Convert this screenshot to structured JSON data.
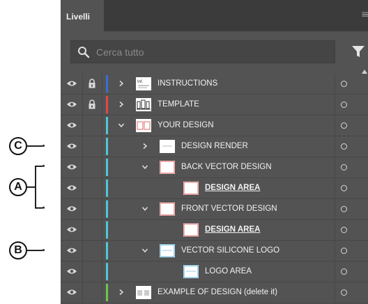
{
  "panel": {
    "tab_label": "Livelli",
    "search_placeholder": "Cerca tutto"
  },
  "layers": [
    {
      "name": "INSTRUCTIONS",
      "level": 0,
      "expanded": false,
      "locked": true,
      "color": "#3a6fd8",
      "thumb": "instructions"
    },
    {
      "name": "TEMPLATE",
      "level": 0,
      "expanded": false,
      "locked": true,
      "color": "#e04848",
      "thumb": "template"
    },
    {
      "name": "YOUR DESIGN",
      "level": 0,
      "expanded": true,
      "locked": false,
      "color": "#4fc8d8",
      "thumb": "design"
    },
    {
      "name": "DESIGN RENDER",
      "level": 1,
      "expanded": false,
      "locked": false,
      "color": "#4fc8d8",
      "thumb": "render"
    },
    {
      "name": "BACK VECTOR DESIGN",
      "level": 1,
      "expanded": true,
      "locked": false,
      "color": "#4fc8d8",
      "thumb": "red-box"
    },
    {
      "name": "DESIGN AREA",
      "level": 2,
      "expanded": null,
      "locked": false,
      "color": "#4fc8d8",
      "thumb": "red-box",
      "underline": true
    },
    {
      "name": "FRONT VECTOR DESIGN",
      "level": 1,
      "expanded": true,
      "locked": false,
      "color": "#4fc8d8",
      "thumb": "red-box"
    },
    {
      "name": "DESIGN AREA",
      "level": 2,
      "expanded": null,
      "locked": false,
      "color": "#4fc8d8",
      "thumb": "red-box",
      "underline": true
    },
    {
      "name": "VECTOR SILICONE LOGO",
      "level": 1,
      "expanded": true,
      "locked": false,
      "color": "#4fc8d8",
      "thumb": "blue-box"
    },
    {
      "name": "LOGO AREA",
      "level": 2,
      "expanded": null,
      "locked": false,
      "color": "#4fc8d8",
      "thumb": "blue-box"
    },
    {
      "name": "EXAMPLE OF DESIGN (delete it)",
      "level": 0,
      "expanded": false,
      "locked": false,
      "color": "#6cc84a",
      "thumb": "example"
    }
  ],
  "callouts": [
    {
      "label": "C"
    },
    {
      "label": "A"
    },
    {
      "label": "B"
    }
  ]
}
